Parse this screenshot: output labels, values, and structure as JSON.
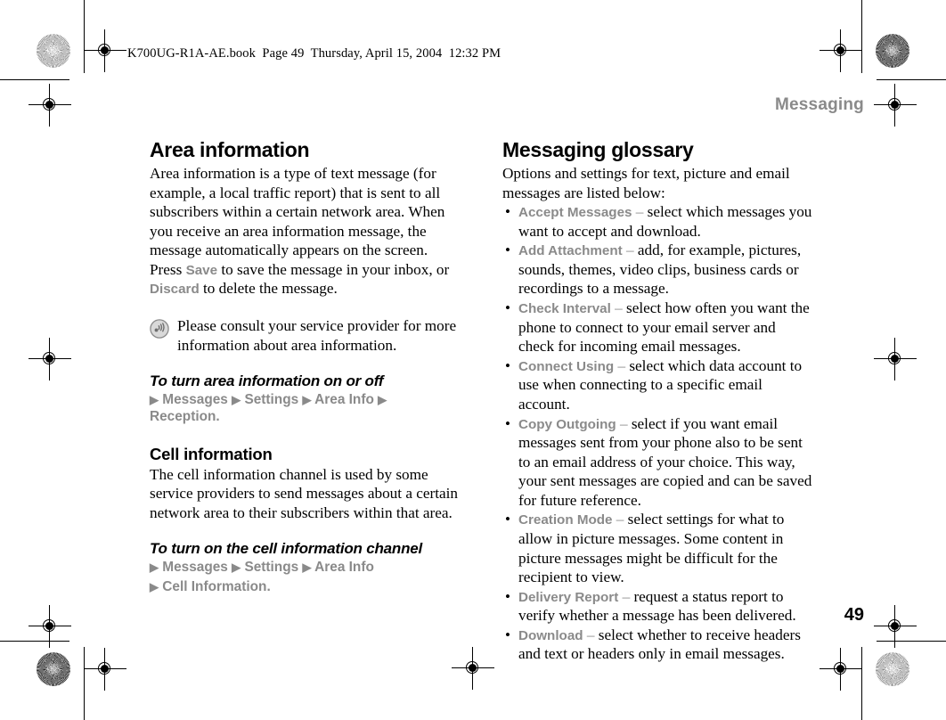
{
  "print_marks": {
    "description": "offset printing registration targets and trim lines",
    "targets": [
      "registration-target",
      "starburst-gauge"
    ]
  },
  "header": {
    "filename_line": "K700UG-R1A-AE.book  Page 49  Thursday, April 15, 2004  12:32 PM",
    "running_head": "Messaging"
  },
  "footer": {
    "page_number": "49"
  },
  "colors": {
    "gui_grey": "#8a8a8a",
    "text_black": "#000000",
    "paper": "#ffffff"
  },
  "left_column": {
    "section_title": "Area information",
    "intro_before_save": "Area information is a type of text message (for example, a local traffic report) that is sent to all subscribers within a certain network area. When you receive an area information message, the message automatically appears on the screen. Press ",
    "gui_save": "Save",
    "intro_mid": " to save the message in your inbox, or ",
    "gui_discard": "Discard",
    "intro_end": " to delete the message.",
    "note": {
      "icon": "tip-broadcast-icon",
      "text": "Please consult your service provider for more information about area information."
    },
    "procedure_1": {
      "heading": "To turn area information on or off",
      "path": [
        "Messages",
        "Settings",
        "Area Info",
        "Reception"
      ],
      "terminator": "."
    },
    "subsection_title": "Cell information",
    "subsection_body": "The cell information channel is used by some service providers to send messages about a certain network area to their subscribers within that area.",
    "procedure_2": {
      "heading": "To turn on the cell information channel",
      "path_line_1": [
        "Messages",
        "Settings",
        "Area Info"
      ],
      "path_line_2": [
        "Cell Information"
      ],
      "terminator": "."
    }
  },
  "right_column": {
    "section_title": "Messaging glossary",
    "intro": "Options and settings for text, picture and email messages are listed below:",
    "items": [
      {
        "term": "Accept Messages",
        "dash": "–",
        "definition": "select which messages you want to accept and download."
      },
      {
        "term": "Add Attachment",
        "dash": "–",
        "definition": "add, for example, pictures, sounds, themes, video clips, business cards or recordings to a message."
      },
      {
        "term": "Check Interval",
        "dash": "–",
        "definition": "select how often you want the phone to connect to your email server and check for incoming email messages."
      },
      {
        "term": "Connect Using",
        "dash": "–",
        "definition": "select which data account to use when connecting to a specific email account."
      },
      {
        "term": "Copy Outgoing",
        "dash": "–",
        "definition": "select if you want email messages sent from your phone also to be sent to an email address of your choice. This way, your sent messages are copied and can be saved for future reference."
      },
      {
        "term": "Creation Mode",
        "dash": "–",
        "definition": "select settings for what to allow in picture messages. Some content in picture messages might be difficult for the recipient to view."
      },
      {
        "term": "Delivery Report",
        "dash": "–",
        "definition": "request a status report to verify whether a message has been delivered."
      },
      {
        "term": "Download",
        "dash": "–",
        "definition": "select whether to receive headers and text or headers only in email messages."
      }
    ]
  }
}
